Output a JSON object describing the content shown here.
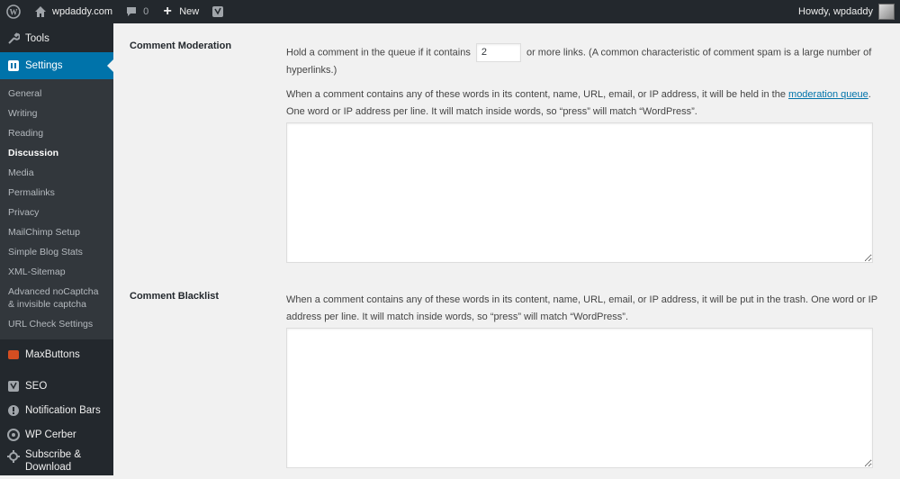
{
  "adminbar": {
    "site_name": "wpdaddy.com",
    "comments_count": "0",
    "new_label": "New",
    "greeting": "Howdy, wpdaddy"
  },
  "sidebar": {
    "top_items": [
      {
        "label": "Tools",
        "icon": "wrench-icon"
      },
      {
        "label": "Settings",
        "icon": "settings-icon"
      }
    ],
    "submenu": [
      "General",
      "Writing",
      "Reading",
      "Discussion",
      "Media",
      "Permalinks",
      "Privacy",
      "MailChimp Setup",
      "Simple Blog Stats",
      "XML-Sitemap",
      "Advanced noCaptcha & invisible captcha",
      "URL Check Settings"
    ],
    "active_sub": "Discussion",
    "bottom_items": [
      {
        "label": "MaxButtons",
        "icon": "maxbuttons-icon"
      },
      {
        "label": "SEO",
        "icon": "yoast-icon"
      },
      {
        "label": "Notification Bars",
        "icon": "notification-icon"
      },
      {
        "label": "WP Cerber",
        "icon": "cerber-icon"
      },
      {
        "label": "Subscribe & Download",
        "icon": "subscribe-icon"
      }
    ]
  },
  "moderation": {
    "label": "Comment Moderation",
    "hold_prefix": "Hold a comment in the queue if it contains",
    "links_value": "2",
    "hold_suffix": "or more links. (A common characteristic of comment spam is a large number of hyperlinks.)",
    "desc_prefix": "When a comment contains any of these words in its content, name, URL, email, or IP address, it will be held in the",
    "desc_link": "moderation queue",
    "desc_suffix": ". One word or IP address per line. It will match inside words, so “press” will match “WordPress”.",
    "keys_value": ""
  },
  "blacklist": {
    "label": "Comment Blacklist",
    "desc": "When a comment contains any of these words in its content, name, URL, email, or IP address, it will be put in the trash. One word or IP address per line. It will match inside words, so “press” will match “WordPress”.",
    "keys_value": ""
  },
  "colors": {
    "admin_dark": "#23282d",
    "submenu_bg": "#32373c",
    "accent": "#0073aa"
  }
}
